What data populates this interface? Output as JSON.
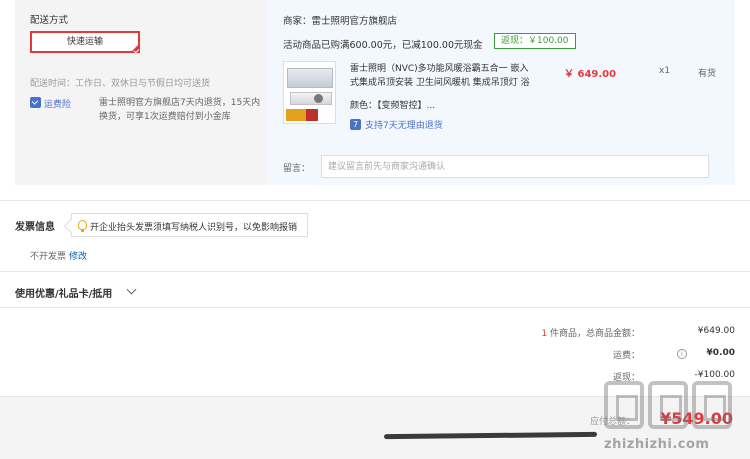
{
  "delivery": {
    "title": "配送方式",
    "shipping_option": "快速运输",
    "time_label": "配送时间：工作日、双休日与节假日均可送货",
    "insurance_label": "运费险",
    "insurance_desc": "雷士照明官方旗舰店7天内退货，15天内换货，可享1次运费赔付到小金库"
  },
  "order": {
    "seller": "商家：雷士照明官方旗舰店",
    "promo": "活动商品已购满600.00元，已减100.00元现金",
    "rebate": "返现：￥100.00",
    "product": {
      "name": "雷士照明（NVC)多功能风暖浴霸五合一 嵌入式集成吊顶安装 卫生间风暖机 集成吊顶灯 浴",
      "price": "￥ 649.00",
      "quantity": "x1",
      "stock": "有货",
      "color_label": "颜色：",
      "color_value": "【变频智控】..."
    },
    "return_badge": "7",
    "return_policy": "支持7天无理由退货",
    "memo_label": "留言：",
    "memo_placeholder": "建议留言前先与商家沟通确认"
  },
  "invoice": {
    "title": "发票信息",
    "tip": "开企业抬头发票须填写纳税人识别号，以免影响报销",
    "status": "不开发票",
    "modify": "修改"
  },
  "coupon": {
    "title": "使用优惠/礼品卡/抵用"
  },
  "summary": {
    "count": "1",
    "total_label": " 件商品，总商品金额：",
    "total_value": "¥649.00",
    "shipping_label": "运费：",
    "shipping_icon_glyph": "i",
    "shipping_value": "¥0.00",
    "rebate_label": "返现：",
    "rebate_value": "-¥100.00",
    "payable_label": "应付总额：",
    "payable_value": "¥549.00"
  },
  "watermark": {
    "url": "zhizhizhi.com"
  }
}
